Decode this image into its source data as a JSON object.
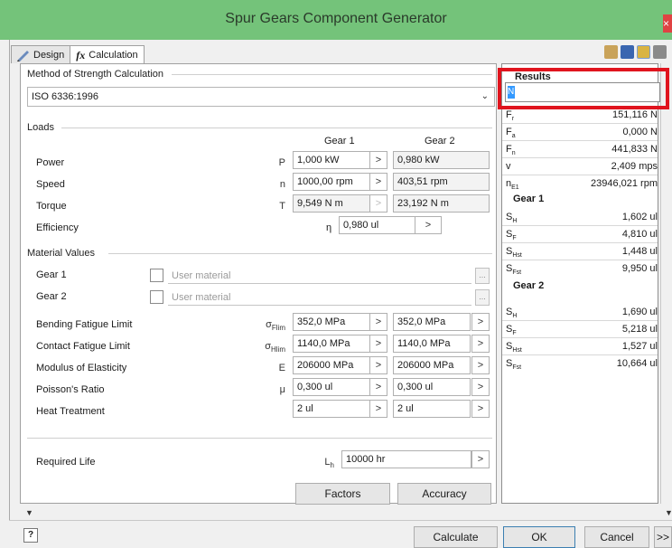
{
  "window": {
    "title": "Spur Gears Component Generator",
    "close_label": "×"
  },
  "tabs": [
    {
      "label": "Design"
    },
    {
      "label": "Calculation",
      "prefix": "fx"
    }
  ],
  "method": {
    "title": "Method of Strength Calculation",
    "selected": "ISO 6336:1996"
  },
  "loads": {
    "title": "Loads",
    "col1": "Gear 1",
    "col2": "Gear 2",
    "rows": [
      {
        "label": "Power",
        "sym": "P",
        "g1": "1,000 kW",
        "g2": "0,980 kW"
      },
      {
        "label": "Speed",
        "sym": "n",
        "g1": "1000,00 rpm",
        "g2": "403,51 rpm"
      },
      {
        "label": "Torque",
        "sym": "T",
        "g1": "9,549 N m",
        "g2": "23,192 N m"
      }
    ],
    "efficiency": {
      "label": "Efficiency",
      "sym": "η",
      "value": "0,980 ul"
    }
  },
  "material": {
    "title": "Material Values",
    "gear1_label": "Gear 1",
    "gear2_label": "Gear 2",
    "user_material": "User material",
    "rows": [
      {
        "label": "Bending Fatigue Limit",
        "sym": "σ",
        "sub": "Flim",
        "g1": "352,0 MPa",
        "g2": "352,0 MPa"
      },
      {
        "label": "Contact Fatigue Limit",
        "sym": "σ",
        "sub": "Hlim",
        "g1": "1140,0 MPa",
        "g2": "1140,0 MPa"
      },
      {
        "label": "Modulus of Elasticity",
        "sym": "E",
        "sub": "",
        "g1": "206000 MPa",
        "g2": "206000 MPa"
      },
      {
        "label": "Poisson's Ratio",
        "sym": "μ",
        "sub": "",
        "g1": "0,300 ul",
        "g2": "0,300 ul"
      },
      {
        "label": "Heat Treatment",
        "sym": "",
        "sub": "",
        "g1": "2 ul",
        "g2": "2 ul"
      }
    ]
  },
  "life": {
    "label": "Required Life",
    "sym": "L",
    "sub": "h",
    "value": "10000 hr"
  },
  "buttons": {
    "factors": "Factors",
    "accuracy": "Accuracy",
    "calculate": "Calculate",
    "ok": "OK",
    "cancel": "Cancel",
    "more": ">>",
    "help": "?"
  },
  "results": {
    "title": "Results",
    "input_value": "N",
    "general": [
      {
        "k": "F",
        "sub": "r",
        "v": "151,116 N"
      },
      {
        "k": "F",
        "sub": "a",
        "v": "0,000 N"
      },
      {
        "k": "F",
        "sub": "n",
        "v": "441,833 N"
      },
      {
        "k": "v",
        "sub": "",
        "v": "2,409 mps"
      },
      {
        "k": "n",
        "sub": "E1",
        "v": "23946,021 rpm"
      }
    ],
    "gear1_title": "Gear 1",
    "gear1": [
      {
        "k": "S",
        "sub": "H",
        "v": "1,602 ul"
      },
      {
        "k": "S",
        "sub": "F",
        "v": "4,810 ul"
      },
      {
        "k": "S",
        "sub": "Hst",
        "v": "1,448 ul"
      },
      {
        "k": "S",
        "sub": "Fst",
        "v": "9,950 ul"
      }
    ],
    "gear2_title": "Gear 2",
    "gear2": [
      {
        "k": "S",
        "sub": "H",
        "v": "1,690 ul"
      },
      {
        "k": "S",
        "sub": "F",
        "v": "5,218 ul"
      },
      {
        "k": "S",
        "sub": "Hst",
        "v": "1,527 ul"
      },
      {
        "k": "S",
        "sub": "Fst",
        "v": "10,664 ul"
      }
    ]
  },
  "colors": {
    "titlebar": "#74c37a",
    "highlight": "#e0141e",
    "selection": "#3399ff"
  }
}
